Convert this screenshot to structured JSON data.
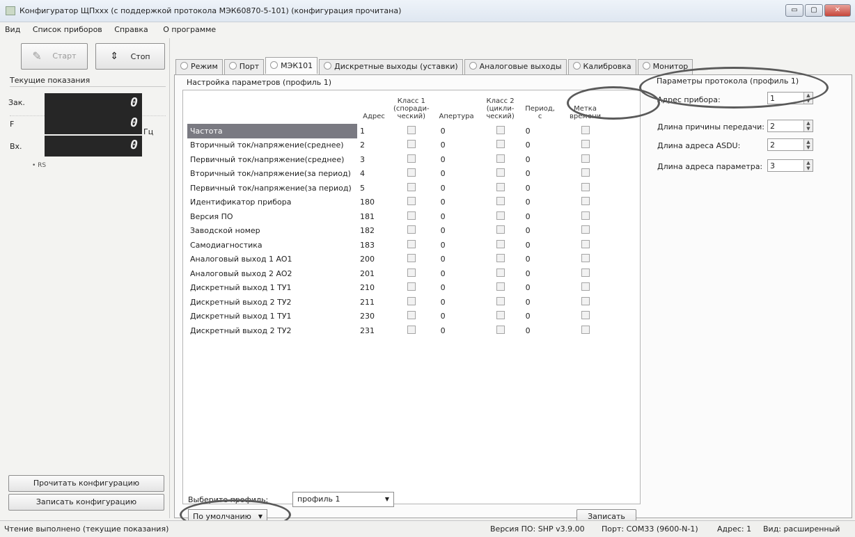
{
  "window": {
    "title": "Конфигуратор ЩПxxx (с поддержкой протокола МЭК60870-5-101) (конфигурация прочитана)",
    "buttons": [
      "▭",
      "▢",
      "✕"
    ]
  },
  "menu": [
    "Вид",
    "Список приборов",
    "Справка",
    "О программе"
  ],
  "left": {
    "start_label": "Старт",
    "stop_label": "Стоп",
    "readings_title": "Текущие показания",
    "readings": [
      {
        "label": "Зак.",
        "value": "0",
        "unit": ""
      },
      {
        "label": "F",
        "value": "0",
        "unit": "Гц"
      },
      {
        "label": "Вх.",
        "value": "0",
        "unit": ""
      }
    ],
    "rs_label": "• RS",
    "read_config_label": "Прочитать конфигурацию",
    "write_config_label": "Записать конфигурацию"
  },
  "tabs": [
    {
      "label": "Режим"
    },
    {
      "label": "Порт"
    },
    {
      "label": "МЭК101"
    },
    {
      "label": "Дискретные выходы (уставки)"
    },
    {
      "label": "Аналоговые выходы"
    },
    {
      "label": "Калибровка"
    },
    {
      "label": "Монитор"
    }
  ],
  "params": {
    "title": "Настройка параметров (профиль 1)",
    "headers": {
      "address": "Адрес",
      "class1": [
        "Класс 1",
        "(споради-",
        "ческий)"
      ],
      "aperture": "Апертура",
      "class2": [
        "Класс 2",
        "(цикли-",
        "ческий)"
      ],
      "period": [
        "Период,",
        "с"
      ],
      "timestamp": [
        "Метка",
        "времени"
      ]
    },
    "rows": [
      {
        "name": "Частота",
        "address": "1",
        "aperture": "0",
        "period": "0"
      },
      {
        "name": "Вторичный ток/напряжение(среднее)",
        "address": "2",
        "aperture": "0",
        "period": "0"
      },
      {
        "name": "Первичный ток/напряжение(среднее)",
        "address": "3",
        "aperture": "0",
        "period": "0"
      },
      {
        "name": "Вторичный ток/напряжение(за период)",
        "address": "4",
        "aperture": "0",
        "period": "0"
      },
      {
        "name": "Первичный ток/напряжение(за период)",
        "address": "5",
        "aperture": "0",
        "period": "0"
      },
      {
        "name": "Идентификатор прибора",
        "address": "180",
        "aperture": "0",
        "period": "0"
      },
      {
        "name": "Версия ПО",
        "address": "181",
        "aperture": "0",
        "period": "0"
      },
      {
        "name": "Заводской номер",
        "address": "182",
        "aperture": "0",
        "period": "0"
      },
      {
        "name": "Самодиагностика",
        "address": "183",
        "aperture": "0",
        "period": "0"
      },
      {
        "name": "Аналоговый выход 1 AO1",
        "address": "200",
        "aperture": "0",
        "period": "0"
      },
      {
        "name": "Аналоговый выход 2 AO2",
        "address": "201",
        "aperture": "0",
        "period": "0"
      },
      {
        "name": "Дискретный выход 1 ТУ1",
        "address": "210",
        "aperture": "0",
        "period": "0"
      },
      {
        "name": "Дискретный выход 2 ТУ2",
        "address": "211",
        "aperture": "0",
        "period": "0"
      },
      {
        "name": "Дискретный выход 1 ТУ1",
        "address": "230",
        "aperture": "0",
        "period": "0"
      },
      {
        "name": "Дискретный выход 2 ТУ2",
        "address": "231",
        "aperture": "0",
        "period": "0"
      }
    ],
    "default_label": "По умолчанию",
    "write_label": "Записать"
  },
  "protocol": {
    "title": "Параметры протокола (профиль 1)",
    "fields": [
      {
        "label": "Адрес прибора:",
        "value": "1"
      },
      {
        "label": "Длина причины передачи:",
        "value": "2"
      },
      {
        "label": "Длина адреса ASDU:",
        "value": "2"
      },
      {
        "label": "Длина адреса параметра:",
        "value": "3"
      }
    ]
  },
  "profile": {
    "label": "Выберите профиль:",
    "value": "профиль 1"
  },
  "status": {
    "message": "Чтение выполнено (текущие показания)",
    "version": "Версия ПО: SHP v3.9.00",
    "port": "Порт: COM33 (9600-N-1)",
    "address": "Адрес: 1",
    "view": "Вид: расширенный"
  }
}
